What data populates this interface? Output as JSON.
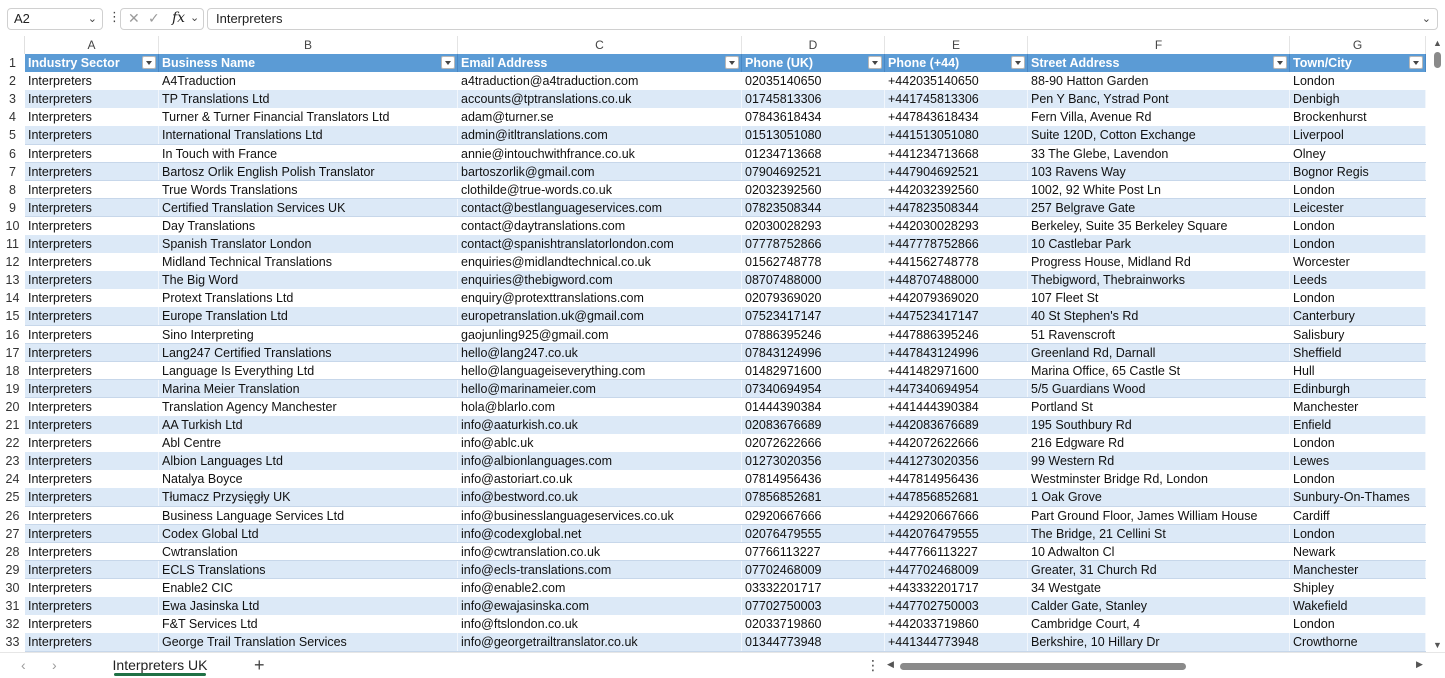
{
  "formula_bar": {
    "name_box": "A2",
    "cancel_glyph": "✕",
    "accept_glyph": "✓",
    "fx_label": "fx",
    "formula_value": "Interpreters"
  },
  "columns": [
    "A",
    "B",
    "C",
    "D",
    "E",
    "F",
    "G"
  ],
  "table": {
    "headers": [
      "Industry Sector",
      "Business Name",
      "Email Address",
      "Phone (UK)",
      "Phone (+44)",
      "Street Address",
      "Town/City"
    ],
    "rows": [
      [
        "Interpreters",
        "A4Traduction",
        "a4traduction@a4traduction.com",
        "02035140650",
        "+442035140650",
        "88-90 Hatton Garden",
        "London"
      ],
      [
        "Interpreters",
        "TP Translations Ltd",
        "accounts@tptranslations.co.uk",
        "01745813306",
        "+441745813306",
        "Pen Y Banc, Ystrad Pont",
        "Denbigh"
      ],
      [
        "Interpreters",
        "Turner & Turner Financial Translators Ltd",
        "adam@turner.se",
        "07843618434",
        "+447843618434",
        "Fern Villa, Avenue Rd",
        "Brockenhurst"
      ],
      [
        "Interpreters",
        "International Translations Ltd",
        "admin@itltranslations.com",
        "01513051080",
        "+441513051080",
        "Suite 120D, Cotton Exchange",
        "Liverpool"
      ],
      [
        "Interpreters",
        "In Touch with France",
        "annie@intouchwithfrance.co.uk",
        "01234713668",
        "+441234713668",
        "33 The Glebe, Lavendon",
        "Olney"
      ],
      [
        "Interpreters",
        "Bartosz Orlik English Polish Translator",
        "bartoszorlik@gmail.com",
        "07904692521",
        "+447904692521",
        "103 Ravens Way",
        "Bognor Regis"
      ],
      [
        "Interpreters",
        "True Words Translations",
        "clothilde@true-words.co.uk",
        "02032392560",
        "+442032392560",
        "1002, 92 White Post Ln",
        "London"
      ],
      [
        "Interpreters",
        "Certified Translation Services UK",
        "contact@bestlanguageservices.com",
        "07823508344",
        "+447823508344",
        "257 Belgrave Gate",
        "Leicester"
      ],
      [
        "Interpreters",
        "Day Translations",
        "contact@daytranslations.com",
        "02030028293",
        "+442030028293",
        "Berkeley, Suite 35 Berkeley Square",
        "London"
      ],
      [
        "Interpreters",
        "Spanish Translator London",
        "contact@spanishtranslatorlondon.com",
        "07778752866",
        "+447778752866",
        "10 Castlebar Park",
        "London"
      ],
      [
        "Interpreters",
        "Midland Technical Translations",
        "enquiries@midlandtechnical.co.uk",
        "01562748778",
        "+441562748778",
        "Progress House, Midland Rd",
        "Worcester"
      ],
      [
        "Interpreters",
        "The Big Word",
        "enquiries@thebigword.com",
        "08707488000",
        "+448707488000",
        "Thebigword, Thebrainworks",
        "Leeds"
      ],
      [
        "Interpreters",
        "Protext Translations Ltd",
        "enquiry@protexttranslations.com",
        "02079369020",
        "+442079369020",
        "107 Fleet St",
        "London"
      ],
      [
        "Interpreters",
        "Europe Translation Ltd",
        "europetranslation.uk@gmail.com",
        "07523417147",
        "+447523417147",
        "40 St Stephen's Rd",
        "Canterbury"
      ],
      [
        "Interpreters",
        "Sino Interpreting",
        "gaojunling925@gmail.com",
        "07886395246",
        "+447886395246",
        "51 Ravenscroft",
        "Salisbury"
      ],
      [
        "Interpreters",
        "Lang247 Certified Translations",
        "hello@lang247.co.uk",
        "07843124996",
        "+447843124996",
        "Greenland Rd, Darnall",
        "Sheffield"
      ],
      [
        "Interpreters",
        "Language Is Everything Ltd",
        "hello@languageiseverything.com",
        "01482971600",
        "+441482971600",
        "Marina Office, 65 Castle St",
        "Hull"
      ],
      [
        "Interpreters",
        "Marina Meier Translation",
        "hello@marinameier.com",
        "07340694954",
        "+447340694954",
        "5/5 Guardians Wood",
        "Edinburgh"
      ],
      [
        "Interpreters",
        "Translation Agency Manchester",
        "hola@blarlo.com",
        "01444390384",
        "+441444390384",
        "Portland St",
        "Manchester"
      ],
      [
        "Interpreters",
        "AA Turkish Ltd",
        "info@aaturkish.co.uk",
        "02083676689",
        "+442083676689",
        "195 Southbury Rd",
        "Enfield"
      ],
      [
        "Interpreters",
        "Abl Centre",
        "info@ablc.uk",
        "02072622666",
        "+442072622666",
        "216 Edgware Rd",
        "London"
      ],
      [
        "Interpreters",
        "Albion Languages Ltd",
        "info@albionlanguages.com",
        "01273020356",
        "+441273020356",
        "99 Western Rd",
        "Lewes"
      ],
      [
        "Interpreters",
        "Natalya Boyce",
        "info@astoriart.co.uk",
        "07814956436",
        "+447814956436",
        "Westminster Bridge Rd, London",
        "London"
      ],
      [
        "Interpreters",
        "Tłumacz Przysięgły UK",
        "info@bestword.co.uk",
        "07856852681",
        "+447856852681",
        "1 Oak Grove",
        "Sunbury-On-Thames"
      ],
      [
        "Interpreters",
        "Business Language Services Ltd",
        "info@businesslanguageservices.co.uk",
        "02920667666",
        "+442920667666",
        "Part Ground Floor, James William House",
        "Cardiff"
      ],
      [
        "Interpreters",
        "Codex Global Ltd",
        "info@codexglobal.net",
        "02076479555",
        "+442076479555",
        "The Bridge, 21 Cellini St",
        "London"
      ],
      [
        "Interpreters",
        "Cwtranslation",
        "info@cwtranslation.co.uk",
        "07766113227",
        "+447766113227",
        "10 Adwalton Cl",
        "Newark"
      ],
      [
        "Interpreters",
        "ECLS Translations",
        "info@ecls-translations.com",
        "07702468009",
        "+447702468009",
        "Greater, 31 Church Rd",
        "Manchester"
      ],
      [
        "Interpreters",
        "Enable2 CIC",
        "info@enable2.com",
        "03332201717",
        "+443332201717",
        "34 Westgate",
        "Shipley"
      ],
      [
        "Interpreters",
        "Ewa Jasinska Ltd",
        "info@ewajasinska.com",
        "07702750003",
        "+447702750003",
        "Calder Gate, Stanley",
        "Wakefield"
      ],
      [
        "Interpreters",
        "F&T Services Ltd",
        "info@ftslondon.co.uk",
        "02033719860",
        "+442033719860",
        "Cambridge Court, 4",
        "London"
      ],
      [
        "Interpreters",
        "George Trail Translation Services",
        "info@georgetrailtranslator.co.uk",
        "01344773948",
        "+441344773948",
        "Berkshire, 10 Hillary Dr",
        "Crowthorne"
      ]
    ]
  },
  "sheet_tabs": {
    "active": "Interpreters UK",
    "add_label": "+"
  },
  "colors": {
    "header_fill": "#5b9bd5",
    "band_fill": "#dce9f7",
    "accent_green": "#1f7145"
  }
}
